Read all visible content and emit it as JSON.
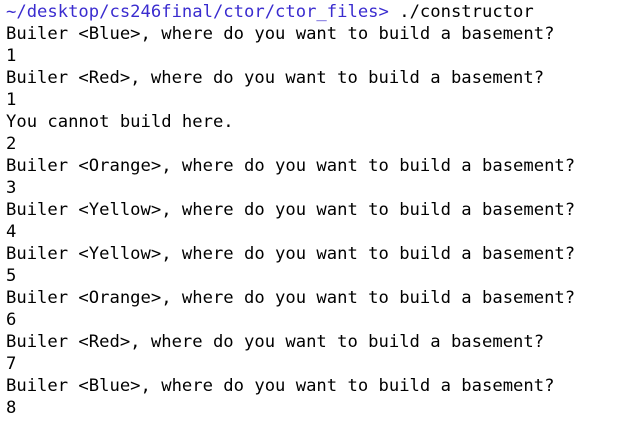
{
  "terminal": {
    "prompt": {
      "path": "~/desktop/cs246final/ctor/ctor_files>",
      "command": " ./constructor"
    },
    "lines": [
      "Builer <Blue>, where do you want to build a basement?",
      "1",
      "Builer <Red>, where do you want to build a basement?",
      "1",
      "You cannot build here.",
      "2",
      "Builer <Orange>, where do you want to build a basement?",
      "3",
      "Builer <Yellow>, where do you want to build a basement?",
      "4",
      "Builer <Yellow>, where do you want to build a basement?",
      "5",
      "Builer <Orange>, where do you want to build a basement?",
      "6",
      "Builer <Red>, where do you want to build a basement?",
      "7",
      "Builer <Blue>, where do you want to build a basement?",
      "8"
    ]
  },
  "colors": {
    "background": "#ffffff",
    "text": "#000000",
    "prompt_path": "#3a2ccf"
  }
}
